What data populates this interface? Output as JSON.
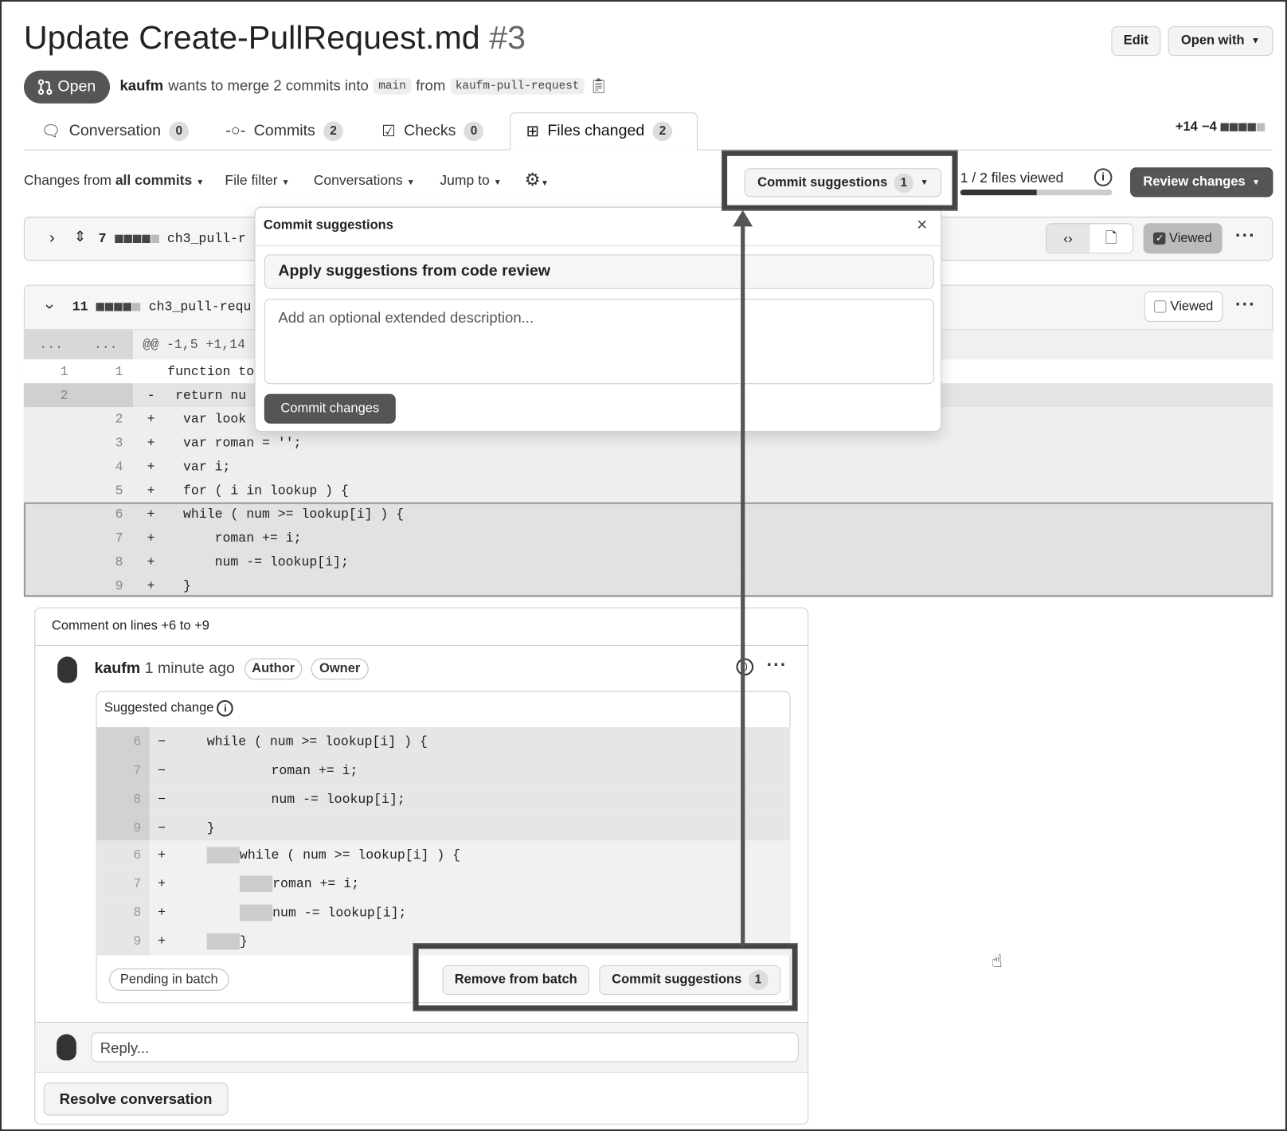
{
  "header": {
    "title": "Update Create-PullRequest.md",
    "number": "#3",
    "edit": "Edit",
    "open_with": "Open with",
    "status": "Open",
    "author": "kaufm",
    "merge_text": "wants to merge 2 commits into",
    "base": "main",
    "from": "from",
    "head": "kaufm-pull-request"
  },
  "tabs": [
    {
      "label": "Conversation",
      "count": "0"
    },
    {
      "label": "Commits",
      "count": "2"
    },
    {
      "label": "Checks",
      "count": "0"
    },
    {
      "label": "Files changed",
      "count": "2"
    }
  ],
  "diffstat": {
    "add": "+14",
    "del": "−4"
  },
  "toolbar": {
    "changes_prefix": "Changes from",
    "changes_value": "all commits",
    "file_filter": "File filter",
    "conversations": "Conversations",
    "jump_to": "Jump to",
    "commit_suggestions": "Commit suggestions",
    "commit_count": "1",
    "files_viewed": "1 / 2 files viewed",
    "files_viewed_fraction": 0.5,
    "review_changes": "Review changes"
  },
  "files": [
    {
      "count": "7",
      "name": "ch3_pull-r",
      "viewed_label": "Viewed",
      "viewed": true
    },
    {
      "count": "11",
      "name": "ch3_pull-requ",
      "viewed_label": "Viewed",
      "viewed": false
    }
  ],
  "diff": {
    "hunk": "@@ -1,5 +1,14",
    "ellipsis": "...",
    "rows": [
      {
        "old": "1",
        "new": "1",
        "sign": "",
        "code": "function toR"
      },
      {
        "old": "2",
        "new": "",
        "sign": "-",
        "code": " return nu"
      },
      {
        "old": "",
        "new": "2",
        "sign": "+",
        "code": "  var look"
      },
      {
        "old": "",
        "new": "3",
        "sign": "+",
        "code": "  var roman = '';"
      },
      {
        "old": "",
        "new": "4",
        "sign": "+",
        "code": "  var i;"
      },
      {
        "old": "",
        "new": "5",
        "sign": "+",
        "code": "  for ( i in lookup ) {"
      },
      {
        "old": "",
        "new": "6",
        "sign": "+",
        "code": "  while ( num >= lookup[i] ) {"
      },
      {
        "old": "",
        "new": "7",
        "sign": "+",
        "code": "      roman += i;"
      },
      {
        "old": "",
        "new": "8",
        "sign": "+",
        "code": "      num -= lookup[i];"
      },
      {
        "old": "",
        "new": "9",
        "sign": "+",
        "code": "  }"
      }
    ]
  },
  "popup": {
    "title": "Commit suggestions",
    "message": "Apply suggestions from code review",
    "description_placeholder": "Add an optional extended description...",
    "commit_button": "Commit changes"
  },
  "comment": {
    "context": "Comment on lines +6 to +9",
    "author": "kaufm",
    "time": "1 minute ago",
    "badges": [
      "Author",
      "Owner"
    ],
    "suggested_label": "Suggested change",
    "removed": [
      {
        "n": "6",
        "code": "while ( num >= lookup[i] ) {"
      },
      {
        "n": "7",
        "code": "    roman += i;"
      },
      {
        "n": "8",
        "code": "    num -= lookup[i];"
      },
      {
        "n": "9",
        "code": "}"
      }
    ],
    "added": [
      {
        "n": "6",
        "code": "while ( num >= lookup[i] ) {"
      },
      {
        "n": "7",
        "code": "roman += i;"
      },
      {
        "n": "8",
        "code": "num -= lookup[i];"
      },
      {
        "n": "9",
        "code": "}"
      }
    ],
    "pending": "Pending in batch",
    "remove_batch": "Remove from batch",
    "commit_suggestions": "Commit suggestions",
    "commit_count": "1",
    "reply_placeholder": "Reply...",
    "resolve": "Resolve conversation"
  }
}
